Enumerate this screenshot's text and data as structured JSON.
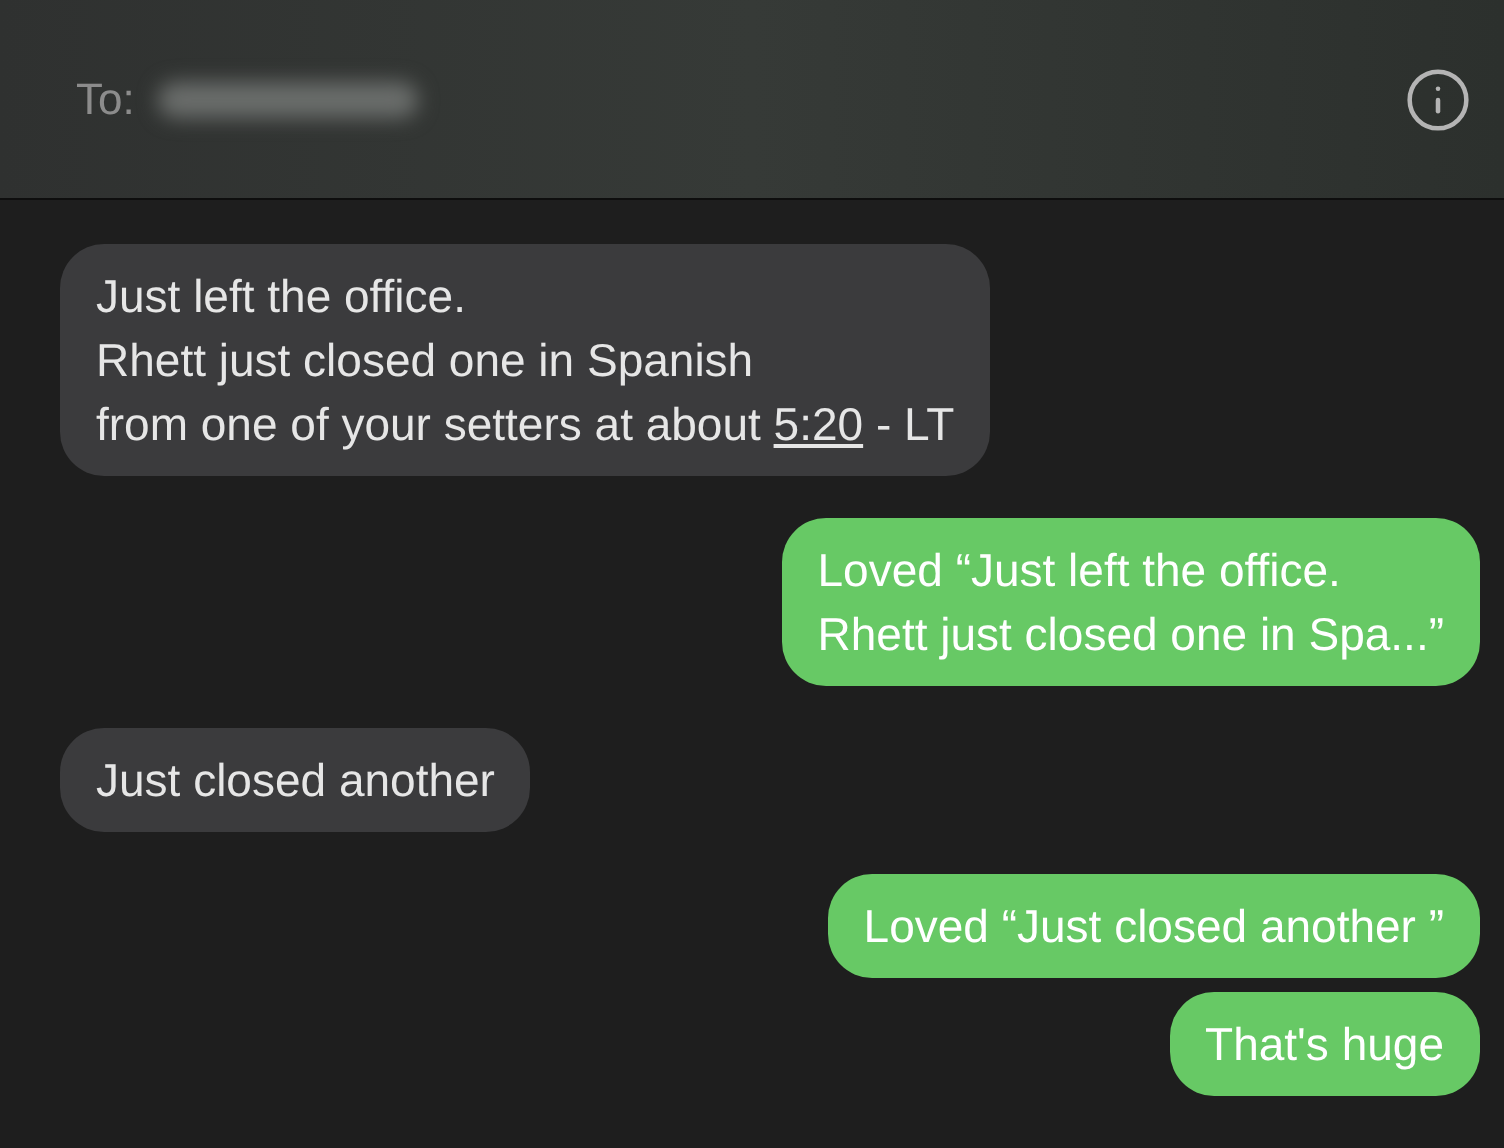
{
  "header": {
    "to_label": "To:"
  },
  "messages": [
    {
      "kind": "incoming",
      "text": "Just left the office.\nRhett just closed one in Spanish\nfrom one of your setters at about ",
      "link": "5:20",
      "after": " - LT"
    },
    {
      "kind": "outgoing",
      "text": "Loved “Just left the office.\nRhett just closed one in Spa...”"
    },
    {
      "kind": "incoming",
      "text": "Just closed another"
    },
    {
      "kind": "outgoing",
      "text": "Loved “Just closed another ”"
    },
    {
      "kind": "outgoing",
      "text": "That's huge"
    }
  ]
}
